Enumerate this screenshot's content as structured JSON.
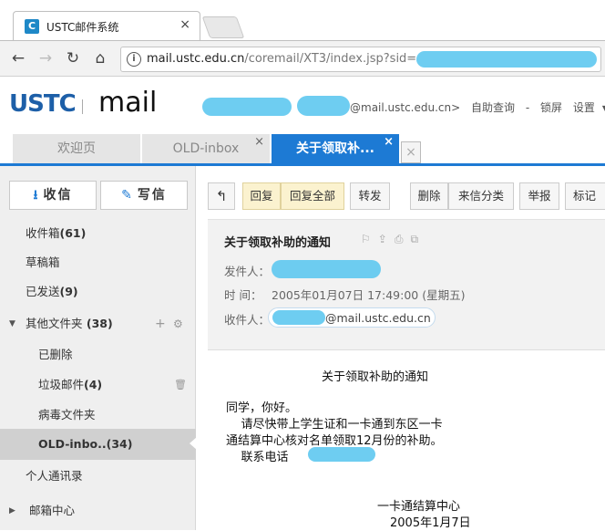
{
  "browser": {
    "tab_title": "USTC邮件系统",
    "favicon_letter": "C",
    "tab_close": "×",
    "url_host": "mail.ustc.edu.cn",
    "url_path": "/coremail/XT3/index.jsp?sid="
  },
  "nav": {
    "back": "←",
    "forward": "→",
    "reload": "↻",
    "home": "⌂",
    "info": "i"
  },
  "mail_header": {
    "logo": "USTC",
    "logo_word": "mail",
    "user_domain": "@mail.ustc.edu.cn>",
    "help": "自助查询",
    "sep": "-",
    "lock": "锁屏",
    "settings": "设置",
    "settings_arrow": "▾"
  },
  "mail_tabs": [
    {
      "label": "欢迎页"
    },
    {
      "label": "OLD-inbox",
      "close": "×"
    },
    {
      "label": "关于领取补...",
      "close": "×"
    }
  ],
  "mail_tab_new": "×",
  "compose": {
    "receive": "收信",
    "receive_icon": "⭳",
    "write": "写信",
    "write_icon": "✎"
  },
  "folders": [
    {
      "label": "收件箱",
      "count": "(61)"
    },
    {
      "label": "草稿箱",
      "count": ""
    },
    {
      "label": "已发送",
      "count": "(9)"
    },
    {
      "label": "其他文件夹",
      "count": " (38)",
      "tri": "▼",
      "add": "+",
      "gear": "⚙"
    },
    {
      "label": "已删除",
      "count": ""
    },
    {
      "label": "垃圾邮件",
      "count": "(4)",
      "trash": "🗑"
    },
    {
      "label": "病毒文件夹",
      "count": ""
    },
    {
      "label": "OLD-inbo..",
      "count": "(34)"
    },
    {
      "label": "个人通讯录",
      "count": ""
    },
    {
      "label": "邮箱中心",
      "count": "",
      "tri": "▶"
    }
  ],
  "toolbar": {
    "back": "↰",
    "reply": "回复",
    "reply_all": "回复全部",
    "forward": "转发",
    "delete": "删除",
    "classify": "来信分类",
    "report": "举报",
    "mark": "标记"
  },
  "message": {
    "subject": "关于领取补助的通知",
    "from_label": "发件人：",
    "time_label": "时    间：",
    "time_value": "2005年01月07日 17:49:00 (星期五)",
    "to_label": "收件人：",
    "to_domain": "@mail.ustc.edu.cn",
    "body_title": "关于领取补助的通知",
    "body_greeting": "同学，你好。",
    "body_line1": "    请尽快带上学生证和一卡通到东区一卡",
    "body_line2": "通结算中心核对名单领取12月份的补助。",
    "body_line3": "    联系电话",
    "sign_org": "一卡通结算中心",
    "sign_date": "2005年1月7日"
  },
  "colors": {
    "accent": "#1d7ad4",
    "logo": "#1d5fa8",
    "redaction": "#5ec8ef"
  }
}
